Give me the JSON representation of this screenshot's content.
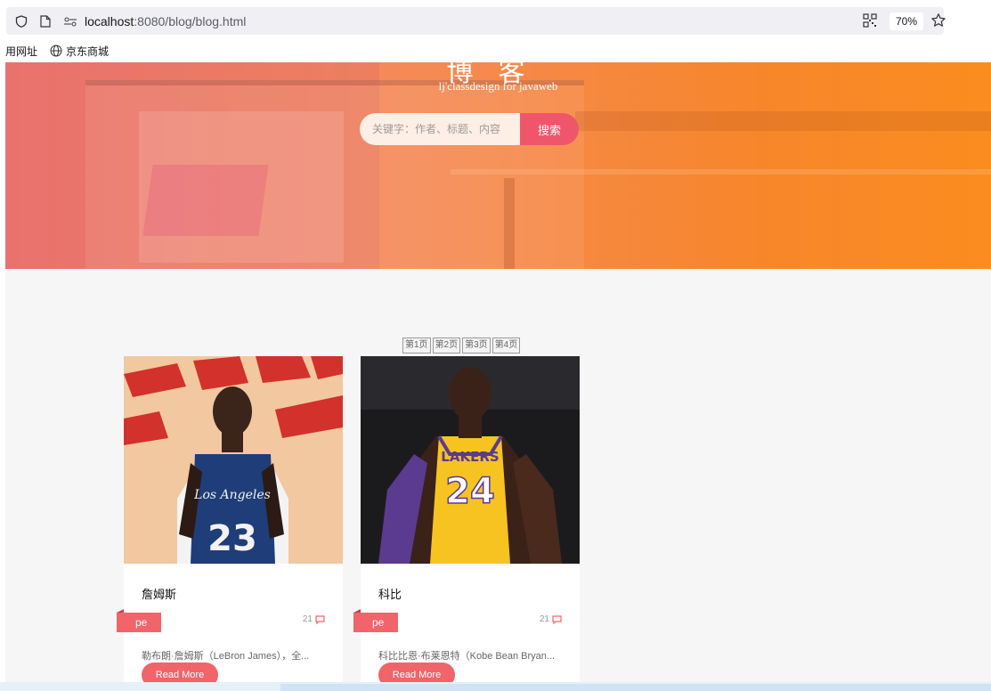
{
  "browser": {
    "url_host": "localhost",
    "url_rest": ":8080/blog/blog.html",
    "zoom": "70%",
    "bookmarks": [
      "用网址",
      "京东商城"
    ]
  },
  "hero": {
    "title": "博客",
    "subtitle": "lj'classdesign for javaweb",
    "search_placeholder": "关键字：作者、标题、内容",
    "search_button": "搜索"
  },
  "pager": [
    "第1页",
    "第2页",
    "第3页",
    "第4页"
  ],
  "posts": [
    {
      "title": "詹姆斯",
      "tag": "pe",
      "comments": "21",
      "excerpt": "勒布朗·詹姆斯（LeBron James），全...",
      "more": "Read More",
      "jersey_number": "23",
      "jersey_text": "Los Angeles"
    },
    {
      "title": "科比",
      "tag": "pe",
      "comments": "21",
      "excerpt": "科比比恩·布莱恩特（Kobe Bean Bryan...",
      "more": "Read More",
      "jersey_number": "24",
      "jersey_text": "LAKERS"
    }
  ],
  "colors": {
    "accent": "#f0646a",
    "hero_left": "#f0776e",
    "hero_right": "#fb8c1f"
  }
}
